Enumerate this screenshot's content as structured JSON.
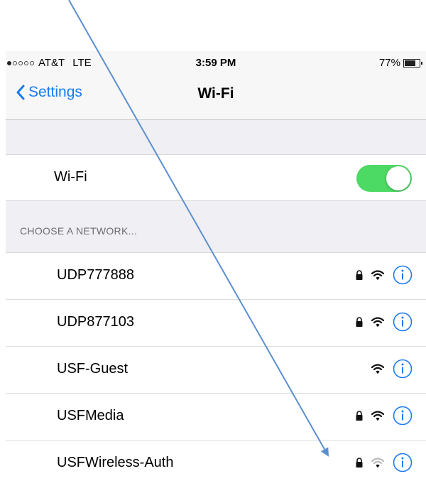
{
  "status_bar": {
    "carrier": "AT&T",
    "network": "LTE",
    "time": "3:59 PM",
    "battery": "77%",
    "battery_level": 0.77
  },
  "nav": {
    "back_label": "Settings",
    "title": "Wi-Fi"
  },
  "wifi_toggle": {
    "label": "Wi-Fi",
    "on": true
  },
  "section_header": "CHOOSE A NETWORK...",
  "networks": [
    {
      "name": "UDP777888",
      "locked": true,
      "signal": "full"
    },
    {
      "name": "UDP877103",
      "locked": true,
      "signal": "full"
    },
    {
      "name": "USF-Guest",
      "locked": false,
      "signal": "full"
    },
    {
      "name": "USFMedia",
      "locked": true,
      "signal": "full"
    },
    {
      "name": "USFWireless-Auth",
      "locked": true,
      "signal": "weak"
    }
  ],
  "colors": {
    "accent": "#1a7bf2",
    "toggle_on": "#4cd964",
    "annotation_arrow": "#5b8fd0"
  },
  "icons": [
    "chevron-left-icon",
    "lock-icon",
    "wifi-icon",
    "info-icon",
    "battery-icon",
    "signal-dots-icon"
  ]
}
